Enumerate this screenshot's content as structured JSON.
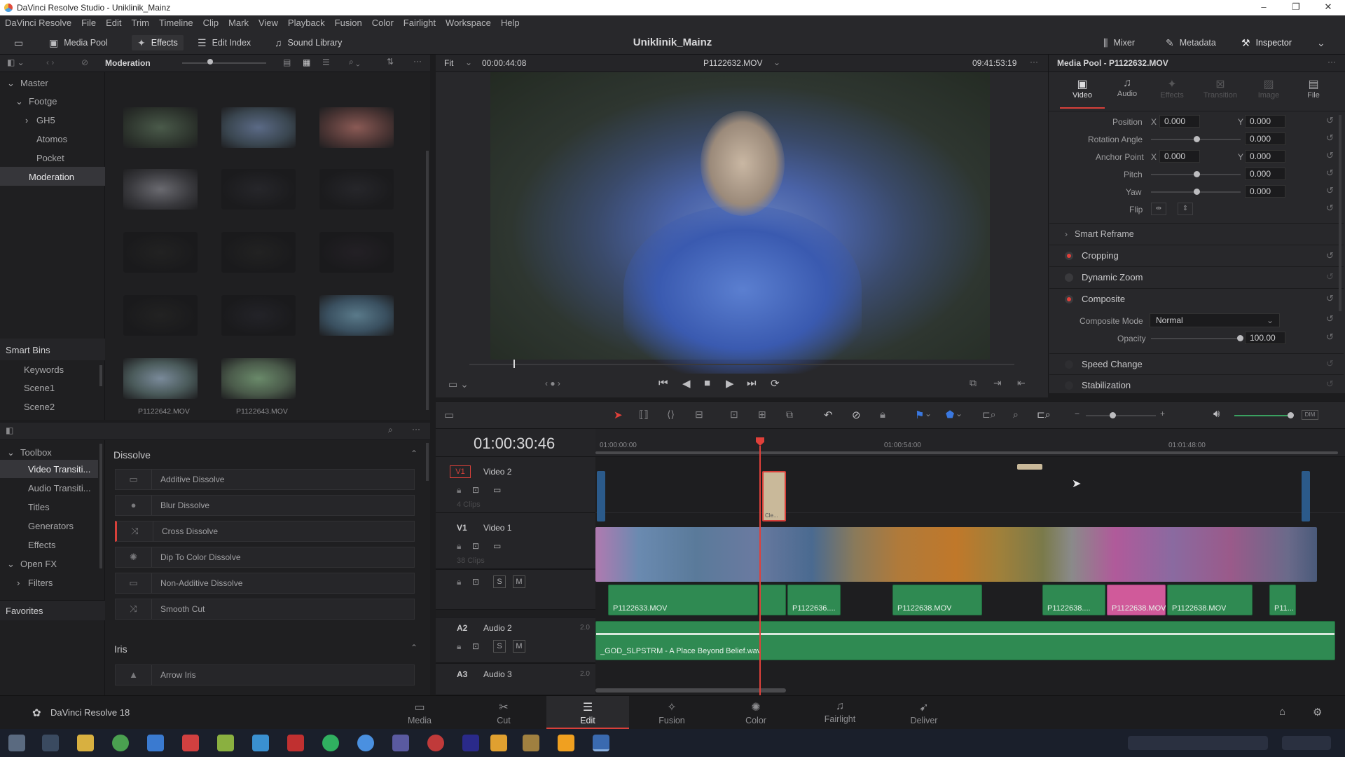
{
  "window": {
    "title": "DaVinci Resolve Studio - Uniklinik_Mainz",
    "minimize": "–",
    "maximize": "❐",
    "close": "✕"
  },
  "menu": [
    "DaVinci Resolve",
    "File",
    "Edit",
    "Trim",
    "Timeline",
    "Clip",
    "Mark",
    "View",
    "Playback",
    "Fusion",
    "Color",
    "Fairlight",
    "Workspace",
    "Help"
  ],
  "toolbar": {
    "media_pool": "Media Pool",
    "effects": "Effects",
    "edit_index": "Edit Index",
    "sound_library": "Sound Library",
    "project_title": "Uniklinik_Mainz",
    "mixer": "Mixer",
    "metadata": "Metadata",
    "inspector": "Inspector"
  },
  "media_pool": {
    "bin_name": "Moderation",
    "tree": [
      "Master",
      "Footge",
      "GH5",
      "Atomos",
      "Pocket",
      "Moderation"
    ],
    "smart_bins_title": "Smart Bins",
    "smart_bins": [
      "Keywords",
      "Scene1",
      "Scene2"
    ],
    "clip_labels": [
      "P1122642.MOV",
      "P1122643.MOV"
    ]
  },
  "effects": {
    "toolbox_title": "Toolbox",
    "categories": [
      "Video Transiti...",
      "Audio Transiti...",
      "Titles",
      "Generators",
      "Effects"
    ],
    "openfx_title": "Open FX",
    "filters": "Filters",
    "favorites": "Favorites",
    "dissolve_title": "Dissolve",
    "dissolve_items": [
      "Additive Dissolve",
      "Blur Dissolve",
      "Cross Dissolve",
      "Dip To Color Dissolve",
      "Non-Additive Dissolve",
      "Smooth Cut"
    ],
    "iris_title": "Iris",
    "iris_items": [
      "Arrow Iris"
    ]
  },
  "viewer": {
    "zoom": "Fit",
    "source_tc": "00:00:44:08",
    "clip_name": "P1122632.MOV",
    "record_tc": "09:41:53:19"
  },
  "inspector": {
    "title": "Media Pool - P1122632.MOV",
    "tabs": [
      "Video",
      "Audio",
      "Effects",
      "Transition",
      "Image",
      "File"
    ],
    "position_label": "Position",
    "position_x": "0.000",
    "position_y": "0.000",
    "rotation_label": "Rotation Angle",
    "rotation": "0.000",
    "anchor_label": "Anchor Point",
    "anchor_x": "0.000",
    "anchor_y": "0.000",
    "pitch_label": "Pitch",
    "pitch": "0.000",
    "yaw_label": "Yaw",
    "yaw": "0.000",
    "flip_label": "Flip",
    "x_label": "X",
    "y_label": "Y",
    "smart_reframe": "Smart Reframe",
    "cropping": "Cropping",
    "dynamic_zoom": "Dynamic Zoom",
    "composite": "Composite",
    "composite_mode_label": "Composite Mode",
    "composite_mode": "Normal",
    "opacity_label": "Opacity",
    "opacity": "100.00",
    "speed_change": "Speed Change",
    "stabilization": "Stabilization"
  },
  "timeline": {
    "timecode": "01:00:30:46",
    "ruler": [
      "01:00:00:00",
      "01:00:54:00",
      "01:01:48:00"
    ],
    "tracks": {
      "v2_id": "V1",
      "v2_name": "Video 2",
      "v2_count": "4 Clips",
      "v1_id": "V1",
      "v1_name": "Video 1",
      "v1_count": "38 Clips",
      "a2_id": "A2",
      "a2_name": "Audio 2",
      "a2_ch": "2.0",
      "a3_id": "A3",
      "a3_name": "Audio 3",
      "a3_ch": "2.0",
      "s": "S",
      "m": "M"
    },
    "v2_clip_label": "Cle...",
    "audio_clips": [
      "P1122633.MOV",
      "P1122636....",
      "P1122638.MOV",
      "P1122638....",
      "P1122638.MOV",
      "P1122638.MOV",
      "P11..."
    ],
    "music_clip": "_GOD_SLPSTRM - A Place Beyond Belief.wav"
  },
  "pages": {
    "app": "DaVinci Resolve 18",
    "items": [
      "Media",
      "Cut",
      "Edit",
      "Fusion",
      "Color",
      "Fairlight",
      "Deliver"
    ]
  },
  "colors": {
    "accent": "#d8403a",
    "audio": "#2f8a52",
    "playhead": "#e0403a"
  }
}
